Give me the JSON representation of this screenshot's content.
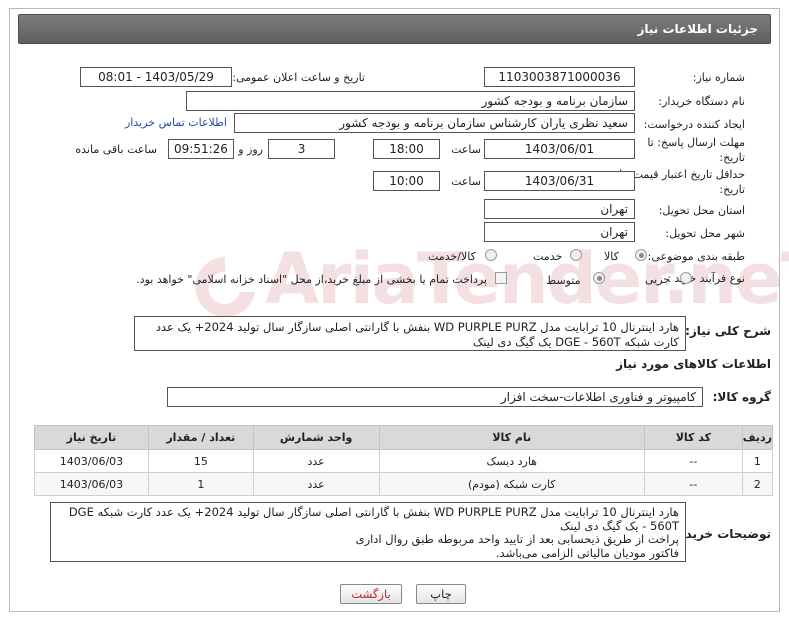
{
  "header": {
    "title": "جزئیات اطلاعات نیاز"
  },
  "form": {
    "need_number_label": "شماره نیاز:",
    "need_number": "1103003871000036",
    "announce_label": "تاریخ و ساعت اعلان عمومی:",
    "announce_value": "1403/05/29 - 08:01",
    "buyer_org_label": "نام دستگاه خریدار:",
    "buyer_org": "سازمان برنامه و بودجه کشور",
    "creator_label": "ایجاد کننده درخواست:",
    "creator": "سعید نظری یاران کارشناس سازمان برنامه و بودجه کشور",
    "buyer_contact_link": "اطلاعات تماس خریدار",
    "deadline_label_1": "مهلت ارسال پاسخ: تا",
    "deadline_label_2": "تاریخ:",
    "deadline_date": "1403/06/01",
    "time_label": "ساعت",
    "deadline_time": "18:00",
    "days_value": "3",
    "days_label": "روز و",
    "remaining_time": "09:51:26",
    "remaining_label": "ساعت باقی مانده",
    "price_validity_label_1": "حداقل تاریخ اعتبار قیمت: تا",
    "price_validity_label_2": "تاریخ:",
    "price_validity_date": "1403/06/31",
    "price_validity_time": "10:00",
    "province_label": "استان محل تحویل:",
    "province": "تهران",
    "city_label": "شهر محل تحویل:",
    "city": "تهران",
    "category_label": "طبقه بندی موضوعی:",
    "category_options": [
      "کالا",
      "خدمت",
      "کالا/خدمت"
    ],
    "process_label": "نوع فرآیند خرید :",
    "process_options": [
      "جزیی",
      "متوسط"
    ],
    "payment_note": "پرداخت تمام یا بخشی از مبلغ خرید،از محل \"اسناد خزانه اسلامی\" خواهد بود.",
    "summary_label": "شرح کلی نیاز:",
    "summary_line1": "هارد اینترنال 10 ترابایت مدل WD PURPLE PURZ بنفش با گارانتی اصلی سازگار سال تولید 2024+ یک عدد",
    "summary_line2": "کارت شبکه DGE - 560T یک گیگ دی لینک"
  },
  "goods": {
    "section_title": "اطلاعات کالاهای مورد نیاز",
    "group_label": "گروه کالا:",
    "group_value": "کامپیوتر و فناوری اطلاعات-سخت افزار",
    "columns": [
      "ردیف",
      "کد کالا",
      "نام کالا",
      "واحد شمارش",
      "تعداد / مقدار",
      "تاریخ نیاز"
    ],
    "rows": [
      [
        "1",
        "--",
        "هارد دیسک",
        "عدد",
        "15",
        "1403/06/03"
      ],
      [
        "2",
        "--",
        "کارت شبکه (مودم)",
        "عدد",
        "1",
        "1403/06/03"
      ]
    ]
  },
  "buyer_notes": {
    "label": "توضیحات خریدار:",
    "line1": "هارد اینترنال 10 ترابایت مدل WD PURPLE PURZ بنفش با گارانتی اصلی سازگار سال تولید 2024+ یک عدد کارت شبکه DGE",
    "line2": "560T - یک گیگ دی لینک",
    "line3": "پراخت از طریق ذیحسابی بعد از تایید واحد مربوطه طبق روال اداری",
    "line4": "فاکتور مودیان مالیاتی الزامی می‌باشد."
  },
  "buttons": {
    "print": "چاپ",
    "back": "بازگشت"
  },
  "watermark_text": "AriaTender.neT"
}
